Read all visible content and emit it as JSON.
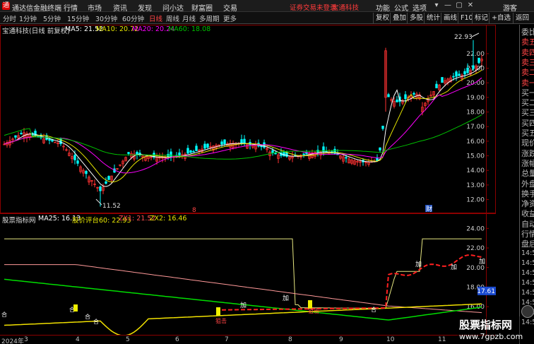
{
  "menubar": {
    "app_title": "通达信金融终端",
    "items": [
      "行情",
      "市场",
      "资讯",
      "发现",
      "问小达",
      "财富圈",
      "交易"
    ],
    "notice": "证券交易未登录",
    "stock_name": "宝通科技",
    "right_items": [
      "功能",
      "公式",
      "选项"
    ],
    "guest": "游客"
  },
  "toolbar": {
    "periods": [
      "分时",
      "1分钟",
      "5分钟",
      "15分钟",
      "30分钟",
      "60分钟",
      "日线",
      "周线",
      "月线",
      "多周期",
      "更多"
    ],
    "active_period": "日线",
    "buttons": [
      "复权",
      "叠加",
      "多股",
      "统计",
      "画线",
      "F10",
      "标记",
      "+自选",
      "返回"
    ]
  },
  "main_chart": {
    "title": "宝通科技(日线 前复权)",
    "ma5_label": "MA5: 21.52",
    "ma10_label": "MA10: 20.72",
    "ma20_label": "MA20: 20.24",
    "ma60_label": "MA60: 18.08",
    "high_label": "22.93",
    "low_label": "11.52",
    "marker1": "8",
    "marker2": "财",
    "y_ticks": [
      "22.00",
      "21.00",
      "20.00",
      "19.00",
      "18.00",
      "17.00",
      "16.00",
      "15.00",
      "14.00",
      "13.00",
      "12.00"
    ],
    "colors": {
      "ma5": "#ffffff",
      "ma10": "#e6e600",
      "ma20": "#ff00ff",
      "ma60": "#00c000",
      "up": "#ff3232",
      "down": "#00ffff"
    }
  },
  "sub_chart": {
    "title": "股票指标网",
    "ma25_label": "MA25: 16.13",
    "price_label": "股价评台60: 22.93",
    "zx1_label": "ZX1: 21.52",
    "zx2_label": "ZX2: 16.46",
    "y_ticks": [
      "24.00",
      "22.00",
      "20.00",
      "18.00",
      "16.00",
      "14.00"
    ],
    "current_value": "17.61",
    "signal_buy": "加",
    "signal_hold": "合",
    "signal_attack": "狙击"
  },
  "xaxis": {
    "labels": [
      "2024年",
      "3",
      "4",
      "5",
      "6",
      "7",
      "8",
      "9",
      "10",
      "11"
    ]
  },
  "sidepanel": {
    "items": [
      "委比",
      "卖五",
      "卖四",
      "卖三",
      "卖二",
      "卖一",
      "买一",
      "买二",
      "买三",
      "买四",
      "买五",
      "现价",
      "涨跌",
      "涨幅",
      "总量",
      "外盘",
      "换手",
      "净资",
      "收益",
      "自动",
      "行情",
      "盘后"
    ],
    "times": [
      "14:50",
      "14:51",
      "14:52",
      "14:53",
      "14:54",
      "14:55",
      "14:56",
      "14:57"
    ]
  },
  "watermark": {
    "line1": "股票指标网",
    "line2": "www.7gpzb.com"
  }
}
